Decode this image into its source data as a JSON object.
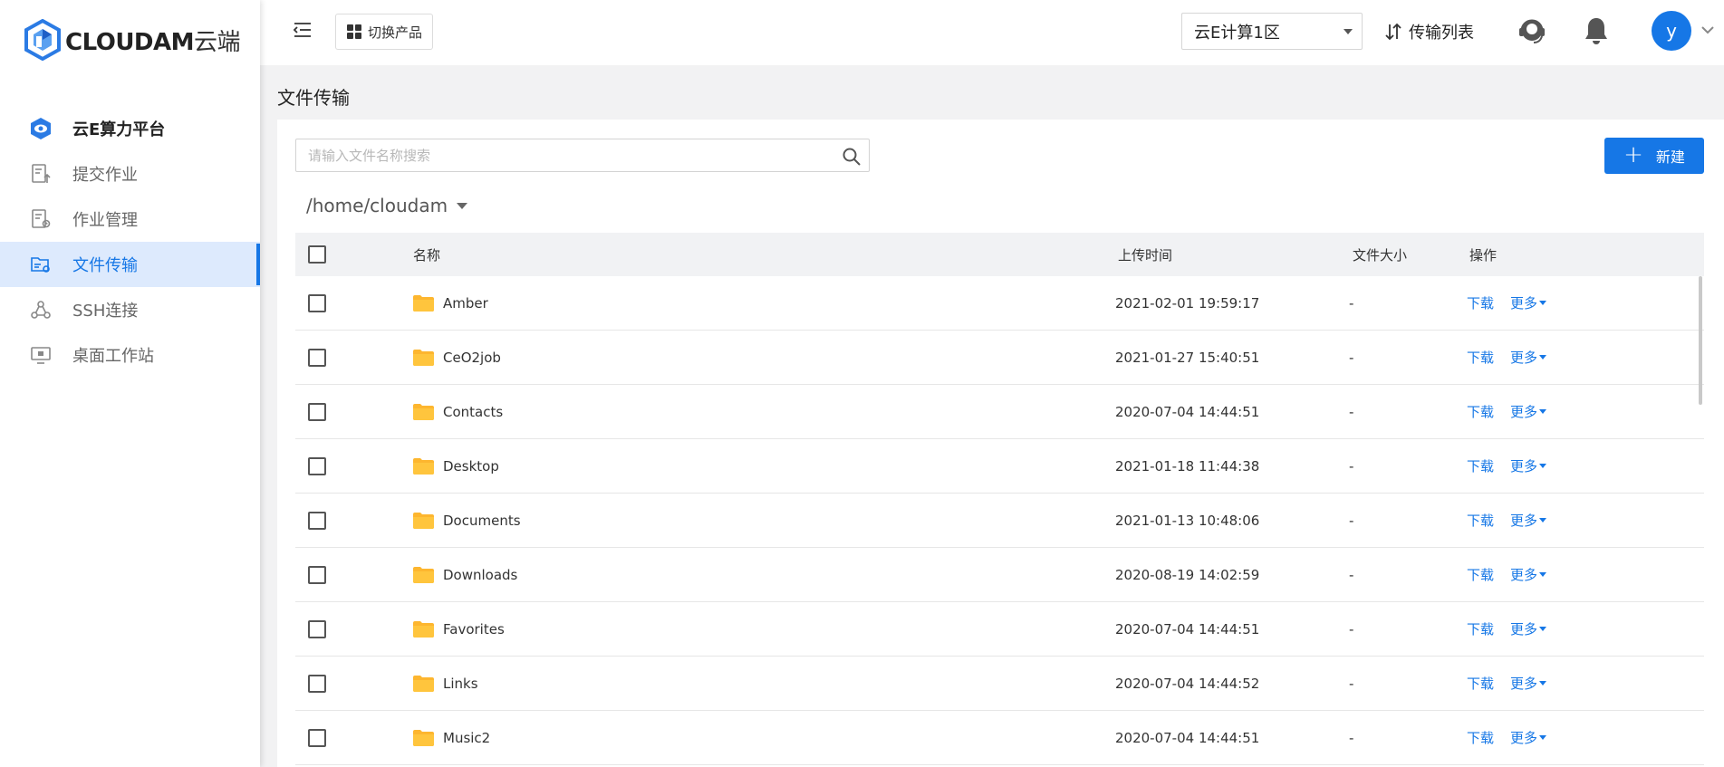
{
  "app": {
    "logo_text_latin": "CLOUDAM",
    "logo_text_cn": "云端",
    "accent_color": "#1677e6"
  },
  "sidebar": {
    "items": [
      {
        "label": "云E算力平台",
        "icon": "platform-eye-icon"
      },
      {
        "label": "提交作业",
        "icon": "submit-job-icon"
      },
      {
        "label": "作业管理",
        "icon": "job-manage-icon"
      },
      {
        "label": "文件传输",
        "icon": "file-transfer-icon"
      },
      {
        "label": "SSH连接",
        "icon": "ssh-icon"
      },
      {
        "label": "桌面工作站",
        "icon": "desktop-icon"
      }
    ]
  },
  "topbar": {
    "switch_label": "切换产品",
    "region": "云E计算1区",
    "transfer_label": "传输列表",
    "avatar_letter": "y"
  },
  "page": {
    "title": "文件传输"
  },
  "search": {
    "placeholder": "请输入文件名称搜索"
  },
  "toolbar": {
    "new_label": "新建"
  },
  "path": {
    "current": "/home/cloudam"
  },
  "table": {
    "headers": {
      "name": "名称",
      "upload_time": "上传时间",
      "size": "文件大小",
      "ops": "操作"
    },
    "download_label": "下载",
    "more_label": "更多",
    "rows": [
      {
        "name": "Amber",
        "time": "2021-02-01 19:59:17",
        "size": "-"
      },
      {
        "name": "CeO2job",
        "time": "2021-01-27 15:40:51",
        "size": "-"
      },
      {
        "name": "Contacts",
        "time": "2020-07-04 14:44:51",
        "size": "-"
      },
      {
        "name": "Desktop",
        "time": "2021-01-18 11:44:38",
        "size": "-"
      },
      {
        "name": "Documents",
        "time": "2021-01-13 10:48:06",
        "size": "-"
      },
      {
        "name": "Downloads",
        "time": "2020-08-19 14:02:59",
        "size": "-"
      },
      {
        "name": "Favorites",
        "time": "2020-07-04 14:44:51",
        "size": "-"
      },
      {
        "name": "Links",
        "time": "2020-07-04 14:44:52",
        "size": "-"
      },
      {
        "name": "Music2",
        "time": "2020-07-04 14:44:51",
        "size": "-"
      }
    ]
  }
}
